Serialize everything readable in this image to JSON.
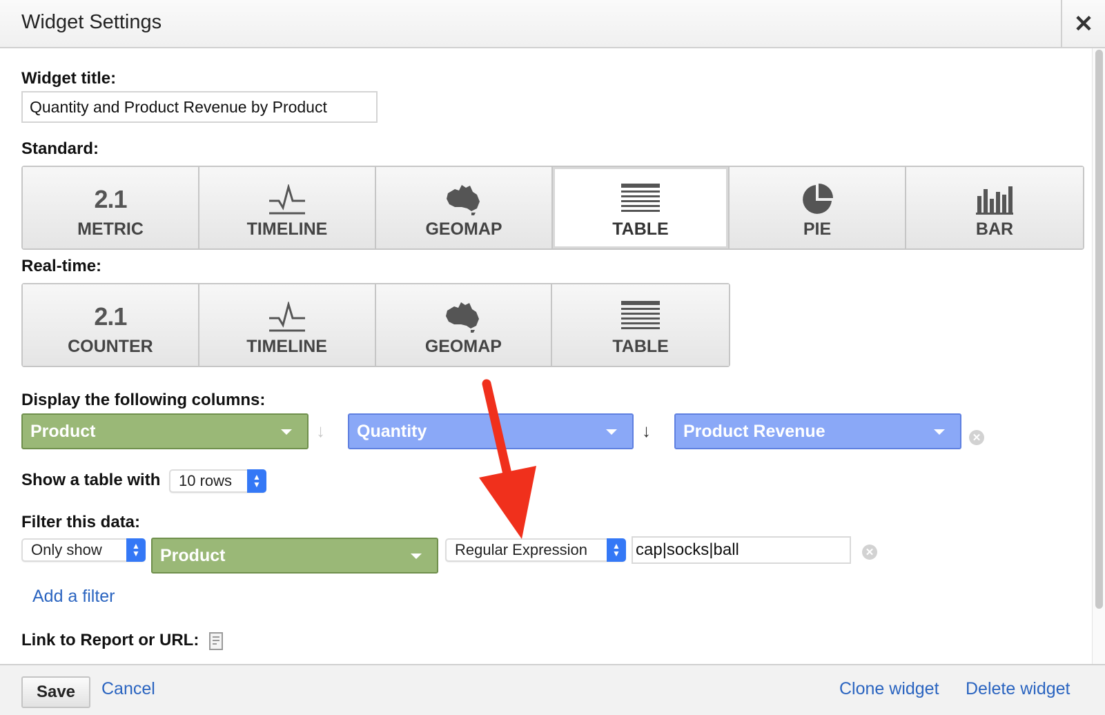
{
  "header": {
    "title": "Widget Settings",
    "close_label": "✕"
  },
  "widget_title": {
    "label": "Widget title:",
    "value": "Quantity and Product Revenue by Product"
  },
  "standard": {
    "label": "Standard:",
    "tiles": [
      {
        "label": "METRIC",
        "icon": "metric-icon",
        "icon_text": "2.1"
      },
      {
        "label": "TIMELINE",
        "icon": "timeline-icon"
      },
      {
        "label": "GEOMAP",
        "icon": "geomap-icon"
      },
      {
        "label": "TABLE",
        "icon": "table-icon",
        "selected": true
      },
      {
        "label": "PIE",
        "icon": "pie-icon"
      },
      {
        "label": "BAR",
        "icon": "bar-icon"
      }
    ]
  },
  "realtime": {
    "label": "Real-time:",
    "tiles": [
      {
        "label": "COUNTER",
        "icon": "counter-icon",
        "icon_text": "2.1"
      },
      {
        "label": "TIMELINE",
        "icon": "timeline-icon"
      },
      {
        "label": "GEOMAP",
        "icon": "geomap-icon"
      },
      {
        "label": "TABLE",
        "icon": "table-icon"
      }
    ]
  },
  "columns": {
    "label": "Display the following columns:",
    "items": [
      {
        "label": "Product",
        "color": "#9ab877"
      },
      {
        "label": "Quantity",
        "color": "#8aa8f7"
      },
      {
        "label": "Product Revenue",
        "color": "#8aa8f7"
      }
    ]
  },
  "rows": {
    "label": "Show a table with",
    "value": "10 rows"
  },
  "filter": {
    "label": "Filter this data:",
    "mode": "Only show",
    "dimension": "Product",
    "match_type": "Regular Expression",
    "value": "cap|socks|ball",
    "add_label": "Add a filter"
  },
  "link": {
    "label": "Link to Report or URL:"
  },
  "footer": {
    "save": "Save",
    "cancel": "Cancel",
    "clone": "Clone widget",
    "delete": "Delete widget"
  },
  "colors": {
    "accent": "#2a64c0",
    "dimension": "#9ab877",
    "metric": "#8aa8f7",
    "annotation_arrow": "#f0301c",
    "spinner": "#3478f6"
  }
}
